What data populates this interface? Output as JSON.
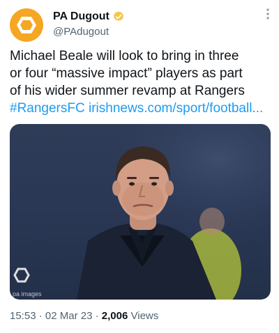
{
  "tweet": {
    "display_name": "PA Dugout",
    "handle": "@PAdugout",
    "more_icon": "more-vertical-icon",
    "verified": true,
    "verified_color": "#f2c94c",
    "avatar_color": "#f5a623",
    "text_lines": [
      "Michael Beale will look to bring in three",
      "or four “massive impact” players as part",
      "of his wider summer revamp at Rangers"
    ],
    "hashtag": "#RangersFC",
    "link": "irishnews.com/sport/football...",
    "media": {
      "watermark": "pa images"
    },
    "time": "15:53",
    "date": "02 Mar 23",
    "separator": "·",
    "views_count": "2,006",
    "views_label": "Views"
  },
  "colors": {
    "link": "#1d9bf0",
    "secondary_text": "#536471",
    "primary_text": "#0f1419"
  }
}
